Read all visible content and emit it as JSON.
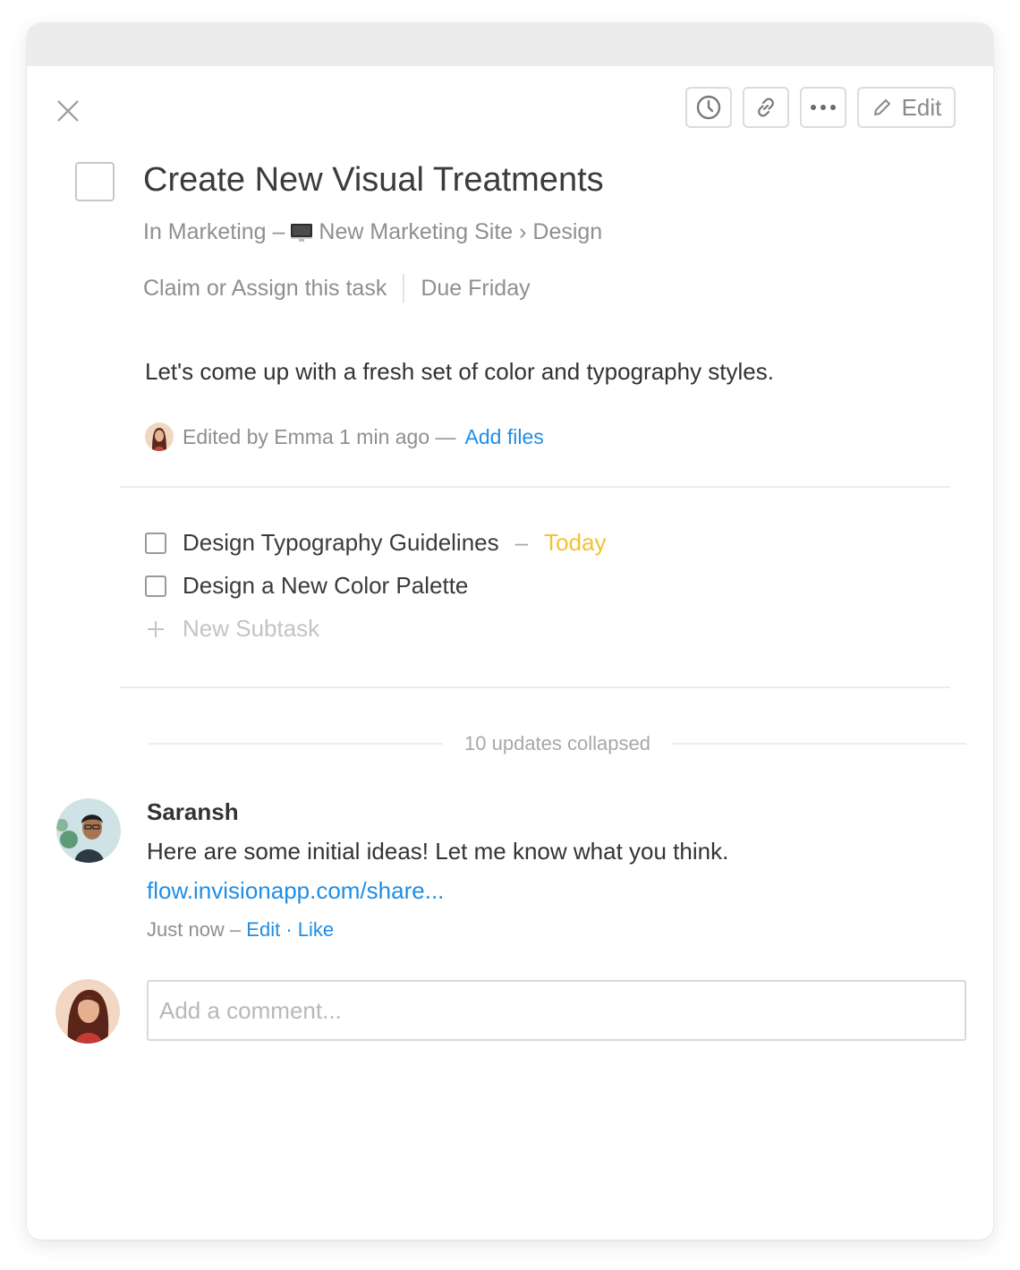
{
  "toolbar": {
    "history_icon": "clock-icon",
    "link_icon": "link-icon",
    "more_icon": "more-dots-icon",
    "edit_label": "Edit",
    "edit_icon": "pencil-icon"
  },
  "task": {
    "title": "Create New Visual Treatments",
    "project_prefix": "In Marketing –",
    "project_name": "New Marketing Site › Design",
    "assign_label": "Claim or Assign this task",
    "due_label": "Due Friday",
    "description": "Let's come up with a fresh set of color and typography styles.",
    "edited_text": "Edited by Emma 1 min ago —",
    "add_files_label": "Add files"
  },
  "subtasks": {
    "items": [
      {
        "title": "Design Typography Guidelines",
        "separator": "–",
        "due": "Today"
      },
      {
        "title": "Design a New Color Palette"
      }
    ],
    "new_label": "New Subtask"
  },
  "activity": {
    "collapsed_label": "10 updates collapsed"
  },
  "comment": {
    "author": "Saransh",
    "text": "Here are some initial ideas! Let me know what you think.",
    "link": "flow.invisionapp.com/share...",
    "time": "Just now –",
    "edit_label": "Edit",
    "dot": "·",
    "like_label": "Like"
  },
  "composer": {
    "placeholder": "Add a comment..."
  },
  "colors": {
    "accent_link": "#1f8ee6",
    "due_today": "#f2c233",
    "text_primary": "#333333",
    "text_muted": "#8f8f8f"
  }
}
